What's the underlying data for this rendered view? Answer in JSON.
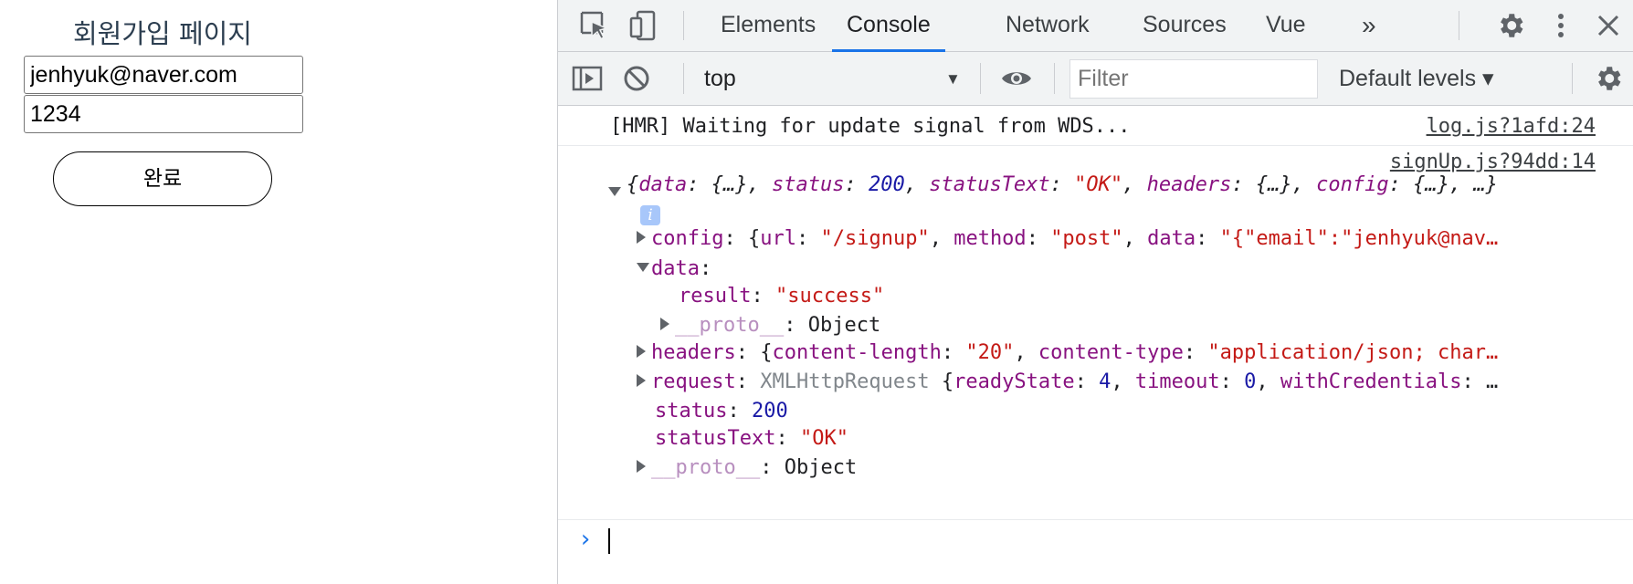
{
  "page": {
    "title": "회원가입 페이지",
    "email_value": "jenhyuk@naver.com",
    "password_value": "1234",
    "submit_label": "완료"
  },
  "devtools": {
    "tabs": [
      "Elements",
      "Console",
      "Network",
      "Sources",
      "Vue"
    ],
    "active_tab": "Console",
    "more_tabs_icon": "»",
    "context": "top",
    "filter_placeholder": "Filter",
    "levels": "Default levels ▾",
    "accent": "#1a73e8"
  },
  "console": {
    "hmr": {
      "text": "[HMR] Waiting for update signal from WDS...",
      "source": "log.js?1afd:24"
    },
    "response": {
      "source": "signUp.js?94dd:14",
      "summary": {
        "open": "{",
        "k_data": "data",
        "v_data": "{…}",
        "k_status": "status",
        "v_status": "200",
        "k_statusText": "statusText",
        "v_statusText": "\"OK\"",
        "k_headers": "headers",
        "v_headers": "{…}",
        "k_config": "config",
        "v_config": "{…}",
        "tail": ", …}"
      },
      "info_badge": "i",
      "config": {
        "key": "config",
        "open": "{",
        "k_url": "url",
        "v_url": "\"/signup\"",
        "k_method": "method",
        "v_method": "\"post\"",
        "k_data": "data",
        "v_data": "\"{\"email\":\"jenhyuk@nav…"
      },
      "data": {
        "key": "data",
        "result_key": "result",
        "result_value": "\"success\"",
        "proto_key": "__proto__",
        "proto_value": "Object"
      },
      "headers": {
        "key": "headers",
        "open": "{",
        "k_len": "content-length",
        "v_len": "\"20\"",
        "k_type": "content-type",
        "v_type": "\"application/json; char…"
      },
      "request": {
        "key": "request",
        "class_name": "XMLHttpRequest",
        "open": "{",
        "k_ready": "readyState",
        "v_ready": "4",
        "k_timeout": "timeout",
        "v_timeout": "0",
        "k_cred": "withCredentials",
        "tail": "…"
      },
      "status": {
        "key": "status",
        "value": "200"
      },
      "statusText": {
        "key": "statusText",
        "value": "\"OK\""
      },
      "proto": {
        "key": "__proto__",
        "value": "Object"
      }
    },
    "prompt_icon": "›"
  }
}
